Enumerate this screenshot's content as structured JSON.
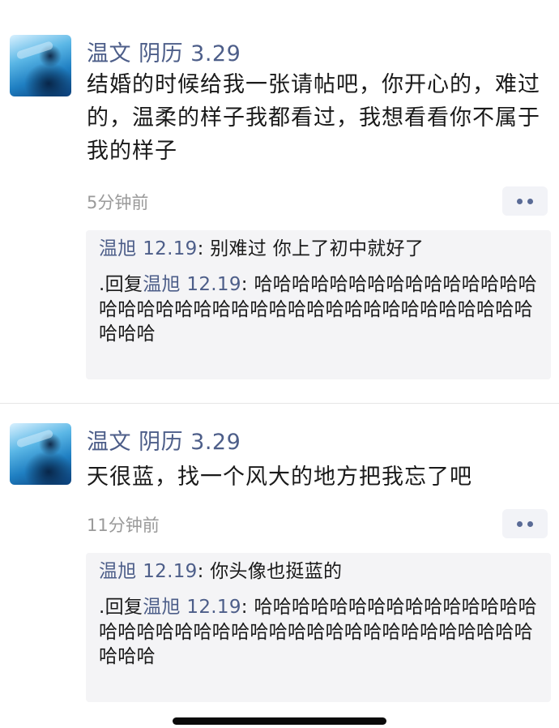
{
  "posts": [
    {
      "author": "温文 阴历 3.29",
      "content": "结婚的时候给我一张请帖吧，你开心的，难过的，温柔的样子我都看过，我想看看你不属于我的样子",
      "time": "5分钟前",
      "comments": [
        {
          "name": "温旭 12.19",
          "sep": ": ",
          "text": "别难过 你上了初中就好了"
        },
        {
          "prefix": ".回复",
          "name": "温旭 12.19",
          "sep": ": ",
          "text": "哈哈哈哈哈哈哈哈哈哈哈哈哈哈哈哈哈哈哈哈哈哈哈哈哈哈哈哈哈哈哈哈哈哈哈哈哈哈哈哈哈"
        }
      ]
    },
    {
      "author": "温文 阴历 3.29",
      "content": "天很蓝，找一个风大的地方把我忘了吧",
      "time": "11分钟前",
      "comments": [
        {
          "name": "温旭 12.19",
          "sep": ": ",
          "text": "你头像也挺蓝的"
        },
        {
          "prefix": ".回复",
          "name": "温旭 12.19",
          "sep": ": ",
          "text": "哈哈哈哈哈哈哈哈哈哈哈哈哈哈哈哈哈哈哈哈哈哈哈哈哈哈哈哈哈哈哈哈哈哈哈哈哈哈哈哈哈"
        }
      ]
    }
  ],
  "icons": {
    "more": "more-dots-icon",
    "avatar": "avatar-ocean-swimmer"
  },
  "colors": {
    "name": "#4d5e89",
    "comment_bg": "#f4f4f6",
    "time": "#9a9a9a"
  }
}
